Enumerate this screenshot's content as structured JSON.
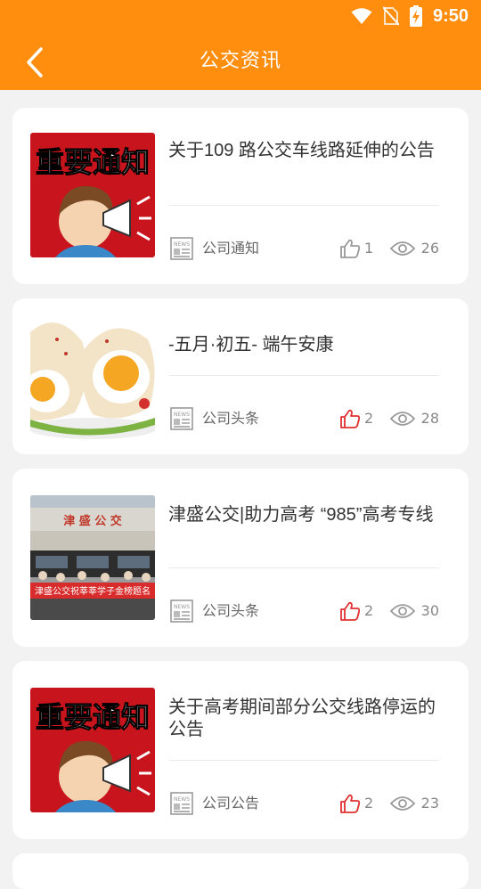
{
  "status_bar": {
    "time": "9:50",
    "icons": [
      "wifi-icon",
      "no-sim-icon",
      "battery-charging-icon"
    ]
  },
  "header": {
    "title": "公交资讯",
    "back_icon": "chevron-left-icon"
  },
  "colors": {
    "header": "#ff8d0e",
    "liked": "#e03030",
    "unliked": "#999999"
  },
  "articles": [
    {
      "title": "关于109 路公交车线路延伸的公告",
      "category": "公司通知",
      "likes": "1",
      "views": "26",
      "liked": false,
      "thumb_text": "重要通知"
    },
    {
      "title": "-五月·初五- 端午安康",
      "category": "公司头条",
      "likes": "2",
      "views": "28",
      "liked": true
    },
    {
      "title": "津盛公交|助力高考 “985”高考专线",
      "category": "公司头条",
      "likes": "2",
      "views": "30",
      "liked": true,
      "thumb_text": "津 盛 公 交",
      "banner_text": "津盛公交祝莘莘学子金榜题名"
    },
    {
      "title": "关于高考期间部分公交线路停运的公告",
      "category": "公司公告",
      "likes": "2",
      "views": "23",
      "liked": true,
      "thumb_text": "重要通知"
    }
  ]
}
